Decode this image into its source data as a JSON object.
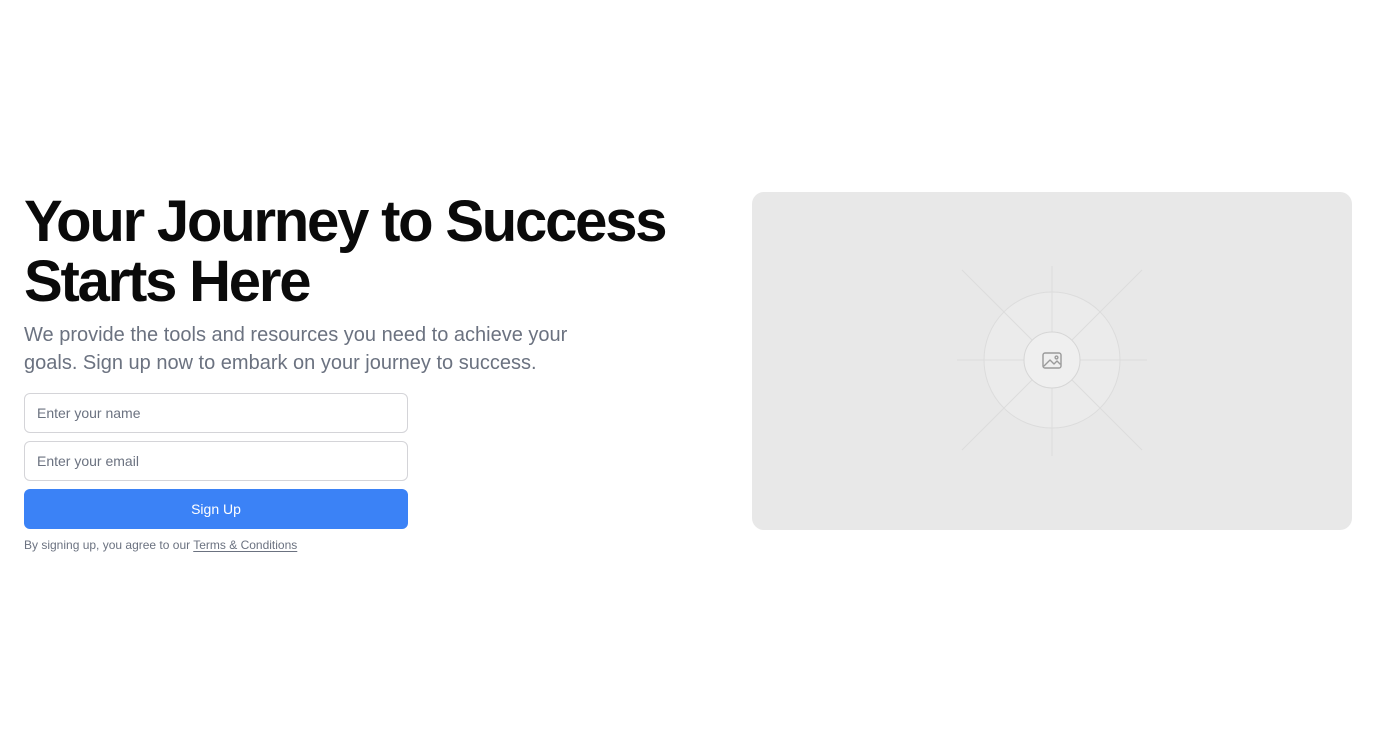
{
  "hero": {
    "headline_line1": "Your Journey to Success",
    "headline_line2": "Starts Here",
    "subtitle": "We provide the tools and resources you need to achieve your goals. Sign up now to embark on your journey to success."
  },
  "form": {
    "name_placeholder": "Enter your name",
    "email_placeholder": "Enter your email",
    "submit_label": "Sign Up",
    "terms_prefix": "By signing up, you agree to our ",
    "terms_link": "Terms & Conditions"
  },
  "image_placeholder": {
    "icon": "image-icon"
  },
  "colors": {
    "accent": "#3b82f6",
    "heading": "#0a0a0a",
    "muted_text": "#6b7280",
    "placeholder_bg": "#e8e8e8"
  }
}
